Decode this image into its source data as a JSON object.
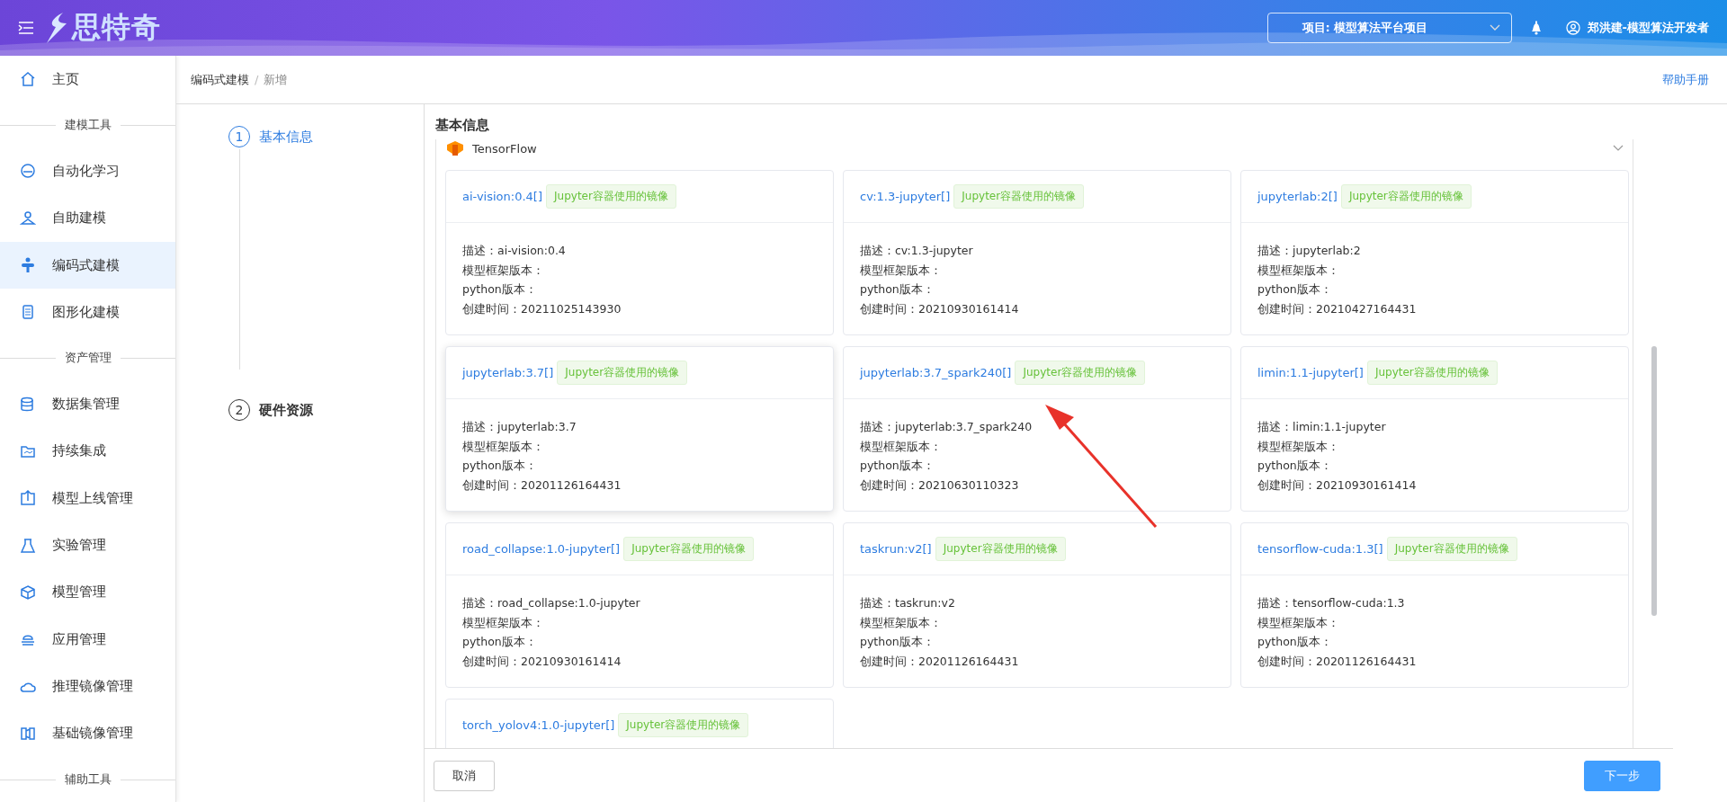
{
  "header": {
    "logo_text": "思特奇",
    "project_select": {
      "value": "项目: 模型算法平台项目"
    },
    "user": "郑洪建-模型算法开发者"
  },
  "sidebar": {
    "items": [
      {
        "kind": "item",
        "label": "主页",
        "selected": false
      },
      {
        "kind": "section",
        "label": "建模工具"
      },
      {
        "kind": "item",
        "label": "自动化学习",
        "selected": false
      },
      {
        "kind": "item",
        "label": "自助建模",
        "selected": false
      },
      {
        "kind": "item",
        "label": "编码式建模",
        "selected": true
      },
      {
        "kind": "item",
        "label": "图形化建模",
        "selected": false
      },
      {
        "kind": "section",
        "label": "资产管理"
      },
      {
        "kind": "item",
        "label": "数据集管理",
        "selected": false
      },
      {
        "kind": "item",
        "label": "持续集成",
        "selected": false
      },
      {
        "kind": "item",
        "label": "模型上线管理",
        "selected": false
      },
      {
        "kind": "item",
        "label": "实验管理",
        "selected": false
      },
      {
        "kind": "item",
        "label": "模型管理",
        "selected": false
      },
      {
        "kind": "item",
        "label": "应用管理",
        "selected": false
      },
      {
        "kind": "item",
        "label": "推理镜像管理",
        "selected": false
      },
      {
        "kind": "item",
        "label": "基础镜像管理",
        "selected": false
      },
      {
        "kind": "section",
        "label": "辅助工具"
      }
    ]
  },
  "breadcrumb": [
    "编码式建模",
    "新增"
  ],
  "breadcrumb_separator": "/",
  "help_link": "帮助手册",
  "steps": [
    {
      "number": "1",
      "label": "基本信息",
      "selected": true
    },
    {
      "number": "2",
      "label": "硬件资源",
      "selected": false
    }
  ],
  "section_title": "基本信息",
  "framework_group": {
    "label": "TensorFlow",
    "expanded": true
  },
  "cards": [
    {
      "title": "ai-vision:0.4[]",
      "tag": "Jupyter容器使用的镜像",
      "hovered": false,
      "lines": [
        "描述：ai-vision:0.4",
        "模型框架版本：",
        "python版本：",
        "创建时间：20211025143930"
      ]
    },
    {
      "title": "cv:1.3-jupyter[]",
      "tag": "Jupyter容器使用的镜像",
      "hovered": false,
      "lines": [
        "描述：cv:1.3-jupyter",
        "模型框架版本：",
        "python版本：",
        "创建时间：20210930161414"
      ]
    },
    {
      "title": "jupyterlab:2[]",
      "tag": "Jupyter容器使用的镜像",
      "hovered": false,
      "lines": [
        "描述：jupyterlab:2",
        "模型框架版本：",
        "python版本：",
        "创建时间：20210427164431"
      ]
    },
    {
      "title": "jupyterlab:3.7[]",
      "tag": "Jupyter容器使用的镜像",
      "hovered": true,
      "lines": [
        "描述：jupyterlab:3.7",
        "模型框架版本：",
        "python版本：",
        "创建时间：20201126164431"
      ]
    },
    {
      "title": "jupyterlab:3.7_spark240[]",
      "tag": "Jupyter容器使用的镜像",
      "hovered": false,
      "lines": [
        "描述：jupyterlab:3.7_spark240",
        "模型框架版本：",
        "python版本：",
        "创建时间：20210630110323"
      ]
    },
    {
      "title": "limin:1.1-jupyter[]",
      "tag": "Jupyter容器使用的镜像",
      "hovered": false,
      "lines": [
        "描述：limin:1.1-jupyter",
        "模型框架版本：",
        "python版本：",
        "创建时间：20210930161414"
      ]
    },
    {
      "title": "road_collapse:1.0-jupyter[]",
      "tag": "Jupyter容器使用的镜像",
      "hovered": false,
      "lines": [
        "描述：road_collapse:1.0-jupyter",
        "模型框架版本：",
        "python版本：",
        "创建时间：20210930161414"
      ]
    },
    {
      "title": "taskrun:v2[]",
      "tag": "Jupyter容器使用的镜像",
      "hovered": false,
      "lines": [
        "描述：taskrun:v2",
        "模型框架版本：",
        "python版本：",
        "创建时间：20201126164431"
      ]
    },
    {
      "title": "tensorflow-cuda:1.3[]",
      "tag": "Jupyter容器使用的镜像",
      "hovered": false,
      "lines": [
        "描述：tensorflow-cuda:1.3",
        "模型框架版本：",
        "python版本：",
        "创建时间：20201126164431"
      ]
    },
    {
      "title": "torch_yolov4:1.0-jupyter[]",
      "tag": "Jupyter容器使用的镜像",
      "hovered": false
    }
  ],
  "buttons": [
    {
      "label": "取消",
      "kind": "default"
    },
    {
      "label": "下一步",
      "kind": "primary"
    }
  ]
}
